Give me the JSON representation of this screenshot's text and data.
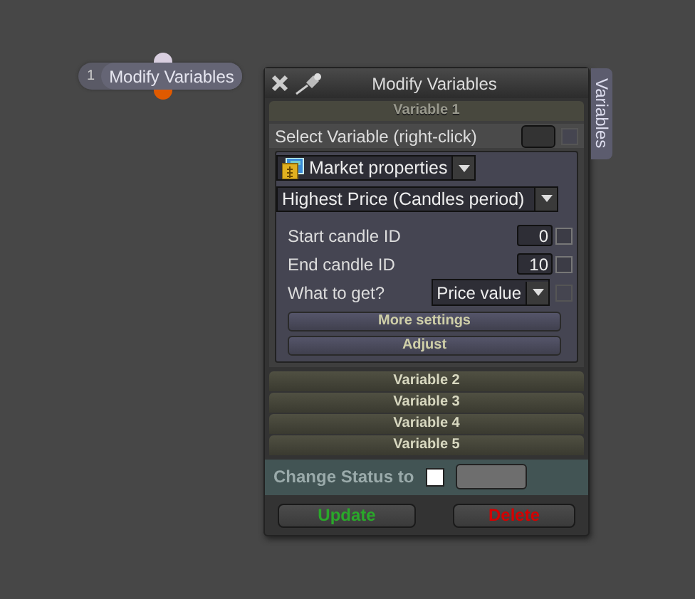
{
  "node": {
    "number": "1",
    "label": "Modify Variables"
  },
  "window": {
    "title": "Modify Variables",
    "side_tab": "Variables"
  },
  "variables": [
    {
      "title": "Variable 1",
      "expanded": true
    },
    {
      "title": "Variable 2",
      "expanded": false
    },
    {
      "title": "Variable 3",
      "expanded": false
    },
    {
      "title": "Variable 4",
      "expanded": false
    },
    {
      "title": "Variable 5",
      "expanded": false
    }
  ],
  "select_variable": {
    "label": "Select Variable (right-click)",
    "checked": false
  },
  "source_dropdown": {
    "value": "Market properties"
  },
  "property_dropdown": {
    "value": "Highest Price (Candles period)"
  },
  "fields": [
    {
      "kind": "number",
      "label": "Start candle ID",
      "value": "0",
      "checked": false
    },
    {
      "kind": "number",
      "label": "End candle ID",
      "value": "10",
      "checked": false
    },
    {
      "kind": "dropdown",
      "label": "What to get?",
      "value": "Price value",
      "checked": false
    }
  ],
  "sub_buttons": [
    "More settings",
    "Adjust"
  ],
  "status": {
    "label": "Change Status to",
    "checked": false
  },
  "buttons": [
    {
      "kind": "update",
      "label": "Update"
    },
    {
      "kind": "delete",
      "label": "Delete"
    }
  ]
}
